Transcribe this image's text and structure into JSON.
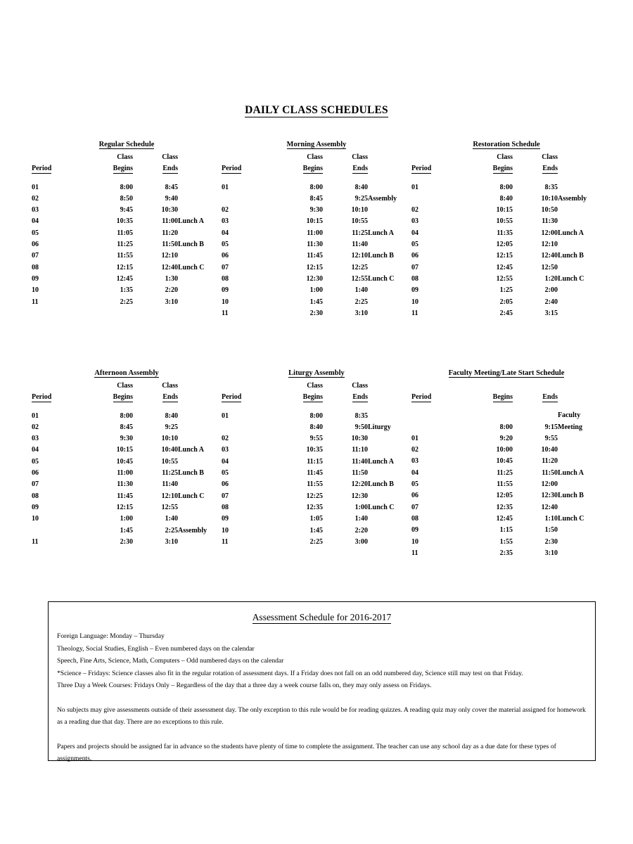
{
  "document": {
    "title": "DAILY CLASS SCHEDULES"
  },
  "headers": {
    "class": "Class",
    "period": "Period",
    "begins": "Begins",
    "ends": "Ends"
  },
  "schedules": [
    {
      "id": "regular-schedule",
      "title": "Regular Schedule",
      "has_class_word": true,
      "rows": [
        {
          "period": "01",
          "begins": "8:00",
          "ends": "8:45",
          "note": ""
        },
        {
          "period": "02",
          "begins": "8:50",
          "ends": "9:40",
          "note": ""
        },
        {
          "period": "03",
          "begins": "9:45",
          "ends": "10:30",
          "note": ""
        },
        {
          "period": "04",
          "begins": "10:35",
          "ends": "11:00",
          "note": "Lunch A"
        },
        {
          "period": "05",
          "begins": "11:05",
          "ends": "11:20",
          "note": ""
        },
        {
          "period": "06",
          "begins": "11:25",
          "ends": "11:50",
          "note": "Lunch B"
        },
        {
          "period": "07",
          "begins": "11:55",
          "ends": "12:10",
          "note": ""
        },
        {
          "period": "08",
          "begins": "12:15",
          "ends": "12:40",
          "note": "Lunch C"
        },
        {
          "period": "09",
          "begins": "12:45",
          "ends": "1:30",
          "note": ""
        },
        {
          "period": "10",
          "begins": "1:35",
          "ends": "2:20",
          "note": ""
        },
        {
          "period": "11",
          "begins": "2:25",
          "ends": "3:10",
          "note": ""
        }
      ]
    },
    {
      "id": "morning-assembly",
      "title": "Morning Assembly",
      "has_class_word": true,
      "rows": [
        {
          "period": "01",
          "begins": "8:00",
          "ends": "8:40",
          "note": ""
        },
        {
          "period": "",
          "begins": "8:45",
          "ends": "9:25",
          "note": "Assembly"
        },
        {
          "period": "02",
          "begins": "9:30",
          "ends": "10:10",
          "note": ""
        },
        {
          "period": "03",
          "begins": "10:15",
          "ends": "10:55",
          "note": ""
        },
        {
          "period": "04",
          "begins": "11:00",
          "ends": "11:25",
          "note": "Lunch A"
        },
        {
          "period": "05",
          "begins": "11:30",
          "ends": "11:40",
          "note": ""
        },
        {
          "period": "06",
          "begins": "11:45",
          "ends": "12:10",
          "note": "Lunch B"
        },
        {
          "period": "07",
          "begins": "12:15",
          "ends": "12:25",
          "note": ""
        },
        {
          "period": "08",
          "begins": "12:30",
          "ends": "12:55",
          "note": "Lunch C"
        },
        {
          "period": "09",
          "begins": "1:00",
          "ends": "1:40",
          "note": ""
        },
        {
          "period": "10",
          "begins": "1:45",
          "ends": "2:25",
          "note": ""
        },
        {
          "period": "11",
          "begins": "2:30",
          "ends": "3:10",
          "note": ""
        }
      ]
    },
    {
      "id": "restoration-schedule",
      "title": "Restoration Schedule",
      "has_class_word": true,
      "rows": [
        {
          "period": "01",
          "begins": "8:00",
          "ends": "8:35",
          "note": ""
        },
        {
          "period": "",
          "begins": "8:40",
          "ends": "10:10",
          "note": "Assembly"
        },
        {
          "period": "02",
          "begins": "10:15",
          "ends": "10:50",
          "note": ""
        },
        {
          "period": "03",
          "begins": "10:55",
          "ends": "11:30",
          "note": ""
        },
        {
          "period": "04",
          "begins": "11:35",
          "ends": "12:00",
          "note": "Lunch A"
        },
        {
          "period": "05",
          "begins": "12:05",
          "ends": "12:10",
          "note": ""
        },
        {
          "period": "06",
          "begins": "12:15",
          "ends": "12:40",
          "note": "Lunch B"
        },
        {
          "period": "07",
          "begins": "12:45",
          "ends": "12:50",
          "note": ""
        },
        {
          "period": "08",
          "begins": "12:55",
          "ends": "1:20",
          "note": "Lunch C"
        },
        {
          "period": "09",
          "begins": "1:25",
          "ends": "2:00",
          "note": ""
        },
        {
          "period": "10",
          "begins": "2:05",
          "ends": "2:40",
          "note": ""
        },
        {
          "period": "11",
          "begins": "2:45",
          "ends": "3:15",
          "note": ""
        }
      ]
    },
    {
      "id": "afternoon-assembly",
      "title": "Afternoon Assembly",
      "has_class_word": true,
      "rows": [
        {
          "period": "01",
          "begins": "8:00",
          "ends": "8:40",
          "note": ""
        },
        {
          "period": "02",
          "begins": "8:45",
          "ends": "9:25",
          "note": ""
        },
        {
          "period": "03",
          "begins": "9:30",
          "ends": "10:10",
          "note": ""
        },
        {
          "period": "04",
          "begins": "10:15",
          "ends": "10:40",
          "note": "Lunch A"
        },
        {
          "period": "05",
          "begins": "10:45",
          "ends": "10:55",
          "note": ""
        },
        {
          "period": "06",
          "begins": "11:00",
          "ends": "11:25",
          "note": "Lunch B"
        },
        {
          "period": "07",
          "begins": "11:30",
          "ends": "11:40",
          "note": ""
        },
        {
          "period": "08",
          "begins": "11:45",
          "ends": "12:10",
          "note": "Lunch C"
        },
        {
          "period": "09",
          "begins": "12:15",
          "ends": "12:55",
          "note": ""
        },
        {
          "period": "10",
          "begins": "1:00",
          "ends": "1:40",
          "note": ""
        },
        {
          "period": "",
          "begins": "1:45",
          "ends": "2:25",
          "note": "Assembly"
        },
        {
          "period": "11",
          "begins": "2:30",
          "ends": "3:10",
          "note": ""
        }
      ]
    },
    {
      "id": "liturgy-assembly",
      "title": "Liturgy Assembly",
      "has_class_word": true,
      "rows": [
        {
          "period": "01",
          "begins": "8:00",
          "ends": "8:35",
          "note": ""
        },
        {
          "period": "",
          "begins": "8:40",
          "ends": "9:50",
          "note": "Liturgy"
        },
        {
          "period": "02",
          "begins": "9:55",
          "ends": "10:30",
          "note": ""
        },
        {
          "period": "03",
          "begins": "10:35",
          "ends": "11:10",
          "note": ""
        },
        {
          "period": "04",
          "begins": "11:15",
          "ends": "11:40",
          "note": "Lunch A"
        },
        {
          "period": "05",
          "begins": "11:45",
          "ends": "11:50",
          "note": ""
        },
        {
          "period": "06",
          "begins": "11:55",
          "ends": "12:20",
          "note": "Lunch B"
        },
        {
          "period": "07",
          "begins": "12:25",
          "ends": "12:30",
          "note": ""
        },
        {
          "period": "08",
          "begins": "12:35",
          "ends": "1:00",
          "note": "Lunch C"
        },
        {
          "period": "09",
          "begins": "1:05",
          "ends": "1:40",
          "note": ""
        },
        {
          "period": "10",
          "begins": "1:45",
          "ends": "2:20",
          "note": ""
        },
        {
          "period": "11",
          "begins": "2:25",
          "ends": "3:00",
          "note": ""
        }
      ]
    },
    {
      "id": "faculty-meeting-late-start-schedule",
      "title": "Faculty Meeting/Late Start Schedule",
      "has_class_word": false,
      "rows": [
        {
          "period": "",
          "begins": "8:00",
          "ends": "9:15",
          "note": "Faculty\nMeeting"
        },
        {
          "period": "01",
          "begins": "9:20",
          "ends": "9:55",
          "note": ""
        },
        {
          "period": "02",
          "begins": "10:00",
          "ends": "10:40",
          "note": ""
        },
        {
          "period": "03",
          "begins": "10:45",
          "ends": "11:20",
          "note": ""
        },
        {
          "period": "04",
          "begins": "11:25",
          "ends": "11:50",
          "note": "Lunch A"
        },
        {
          "period": "05",
          "begins": "11:55",
          "ends": "12:00",
          "note": ""
        },
        {
          "period": "06",
          "begins": "12:05",
          "ends": "12:30",
          "note": "Lunch B"
        },
        {
          "period": "07",
          "begins": "12:35",
          "ends": "12:40",
          "note": ""
        },
        {
          "period": "08",
          "begins": "12:45",
          "ends": "1:10",
          "note": "Lunch C"
        },
        {
          "period": "09",
          "begins": "1:15",
          "ends": "1:50",
          "note": ""
        },
        {
          "period": "10",
          "begins": "1:55",
          "ends": "2:30",
          "note": ""
        },
        {
          "period": "11",
          "begins": "2:35",
          "ends": "3:10",
          "note": ""
        }
      ]
    }
  ],
  "assessment": {
    "title": "Assessment Schedule for 2016-2017",
    "lines": [
      "Foreign Language:  Monday – Thursday",
      "Theology, Social Studies, English – Even numbered days on the calendar",
      "Speech, Fine Arts, Science, Math, Computers – Odd numbered days on the calendar",
      "*Science – Fridays: Science classes also fit in the regular rotation of assessment days. If a Friday does not fall on an odd numbered day, Science still may test on that Friday.",
      "Three Day a Week Courses:  Fridays Only – Regardless of the day that a three day a week course falls on, they may only assess on Fridays."
    ],
    "paragraphs": [
      "No subjects may give assessments outside of their assessment day. The only exception to this rule would be for reading quizzes.  A reading quiz may only cover the material assigned for homework as a reading due that day.  There are no exceptions to this rule.",
      "Papers and projects should be assigned far in advance so the students have plenty of time to complete the assignment.  The teacher can use any school day as a due date for these types of  assignments."
    ]
  }
}
